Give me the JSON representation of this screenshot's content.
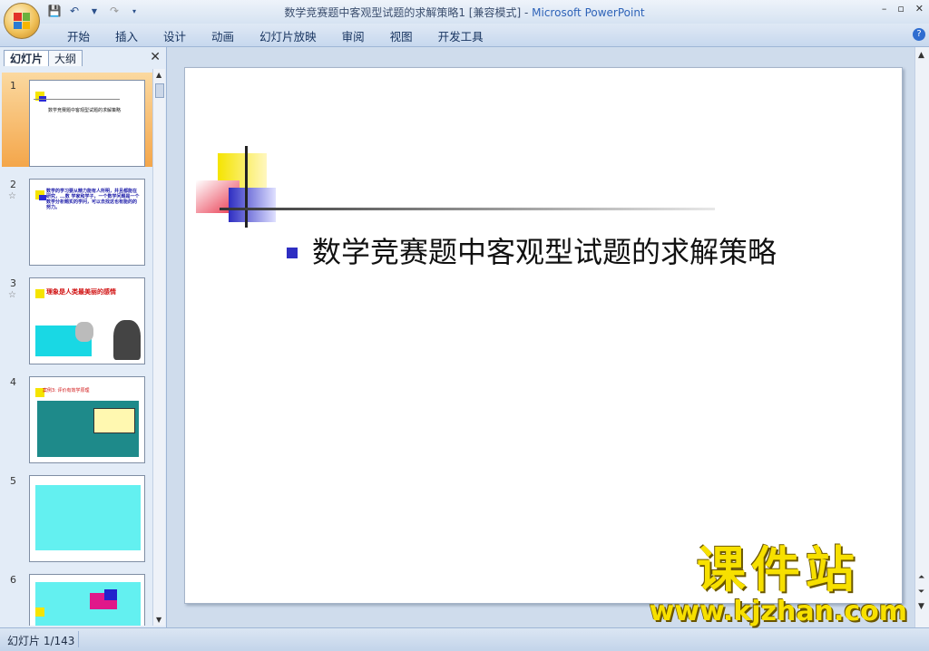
{
  "window": {
    "title": "数学竞赛题中客观型试题的求解策略1 [兼容模式] - ",
    "app_name": "Microsoft PowerPoint"
  },
  "ribbon": {
    "tabs": [
      "开始",
      "插入",
      "设计",
      "动画",
      "幻灯片放映",
      "审阅",
      "视图",
      "开发工具"
    ]
  },
  "left_panel": {
    "tabs": [
      "幻灯片",
      "大纲"
    ],
    "thumbnails": [
      {
        "num": "1",
        "text": "数学竞赛题中客观型试题的求解策略",
        "selected": true
      },
      {
        "num": "2",
        "text": "数学的学习要从精力能有人所明，并且都能在研究，...数 学家和学子，一个数学问题是一个数学分析题实的学问，可以去找这也有能的的努力。",
        "selected": false
      },
      {
        "num": "3",
        "text": "理象是人类最美丽的感情",
        "selected": false
      },
      {
        "num": "4",
        "text": "案例3: 评价有效学原理",
        "selected": false
      },
      {
        "num": "5",
        "text": "",
        "selected": false
      },
      {
        "num": "6",
        "text": "",
        "selected": false
      }
    ]
  },
  "slide": {
    "bullet_text": "数学竞赛题中客观型试题的求解策略"
  },
  "status_bar": {
    "slide_indicator": "幻灯片 1/143"
  },
  "watermark": {
    "brand": "课件站",
    "url": "www.kjzhan.com"
  },
  "colors": {
    "deco_yellow": "#f5e400",
    "deco_blue": "#2e2ec2",
    "deco_red": "#e8334a",
    "selected_thumb": "#f4a64a"
  }
}
